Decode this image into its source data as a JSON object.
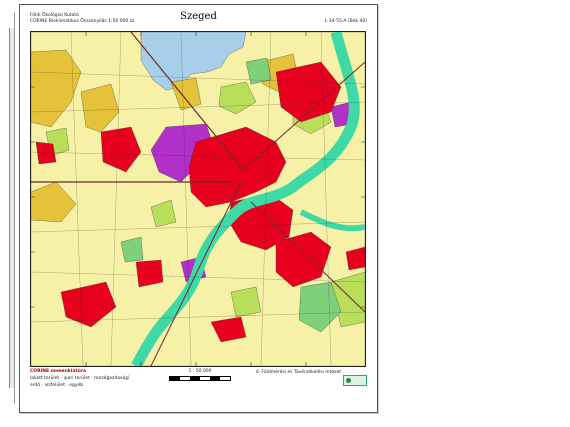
{
  "sheet": {
    "title": "Szeged",
    "publisher": "Földi Ökológiai Kutató",
    "series": "CORINE Bioklimatikus Összenyílás 1:50 000 sz.",
    "sheet_id": "L-34-55-A (Bék 40)"
  },
  "legend": {
    "line1": "CORINE nomenklatúra",
    "line2": "lakott terület · ipari terület · mezőgazdasági",
    "line3": "erdő · vízfelület · egyéb"
  },
  "scale": {
    "label": "1 : 50 000"
  },
  "credit": "© Földmérési és Távérzékelési Intézet",
  "colors": {
    "urban": "#e8001f",
    "industrial": "#b030c8",
    "agricultural": "#f6f1a6",
    "orchard": "#e6c23a",
    "grassland": "#b9de5a",
    "forest": "#7fd07a",
    "water": "#3fd9a6",
    "lake": "#a8cfe9",
    "road": "#6e2b2b",
    "boundary": "#2b2b2b"
  }
}
